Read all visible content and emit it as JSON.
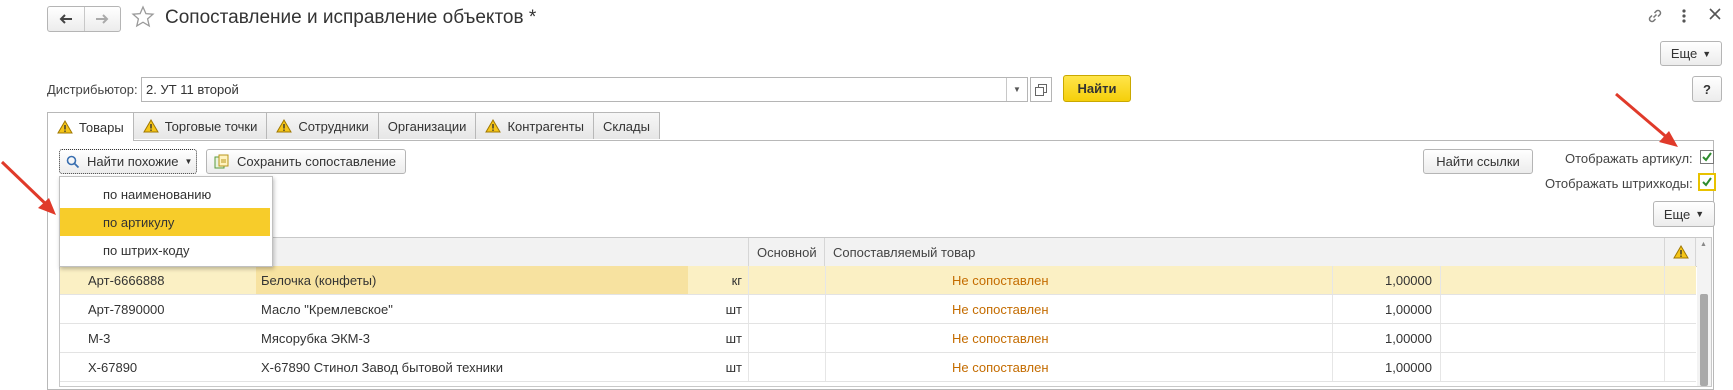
{
  "window": {
    "title": "Сопоставление и исправление объектов *",
    "more_label": "Еще",
    "help_label": "?"
  },
  "filter": {
    "distributor_label": "Дистрибьютор:",
    "distributor_value": "2. УТ 11 второй",
    "find_label": "Найти"
  },
  "tabs": [
    {
      "label": "Товары",
      "warning": true,
      "active": true
    },
    {
      "label": "Торговые точки",
      "warning": true,
      "active": false
    },
    {
      "label": "Сотрудники",
      "warning": true,
      "active": false
    },
    {
      "label": "Организации",
      "warning": false,
      "active": false
    },
    {
      "label": "Контрагенты",
      "warning": true,
      "active": false
    },
    {
      "label": "Склады",
      "warning": false,
      "active": false
    }
  ],
  "toolbar": {
    "find_similar_label": "Найти похожие",
    "save_mapping_label": "Сохранить сопоставление",
    "find_links_label": "Найти ссылки",
    "show_article_label": "Отображать артикул:",
    "show_barcodes_label": "Отображать штрихкоды:",
    "show_article_checked": true,
    "show_barcodes_checked": true,
    "more_label": "Еще"
  },
  "dropdown": {
    "items": [
      {
        "label": "по наименованию",
        "highlighted": false
      },
      {
        "label": "по артикулу",
        "highlighted": true
      },
      {
        "label": "по штрих-коду",
        "highlighted": false
      }
    ]
  },
  "table": {
    "columns": [
      "Основной",
      "Сопоставляемый товар"
    ],
    "rows": [
      {
        "article": "Арт-6666888",
        "name": "Белочка (конфеты)",
        "unit": "кг",
        "status": "Не сопоставлен",
        "qty": "1,00000"
      },
      {
        "article": "Арт-7890000",
        "name": "Масло \"Кремлевское\"",
        "unit": "шт",
        "status": "Не сопоставлен",
        "qty": "1,00000"
      },
      {
        "article": "М-3",
        "name": "Мясорубка ЭКМ-3",
        "unit": "шт",
        "status": "Не сопоставлен",
        "qty": "1,00000"
      },
      {
        "article": "Х-67890",
        "name": "Х-67890 Стинол Завод бытовой техники",
        "unit": "шт",
        "status": "Не сопоставлен",
        "qty": "1,00000"
      }
    ]
  },
  "colors": {
    "accent_yellow": "#f5cf0a",
    "selected_row": "#fbf0c4",
    "status_orange": "#c46c00",
    "annotation_arrow": "#e03a2a",
    "checkbox_green": "#2e8b2e"
  }
}
